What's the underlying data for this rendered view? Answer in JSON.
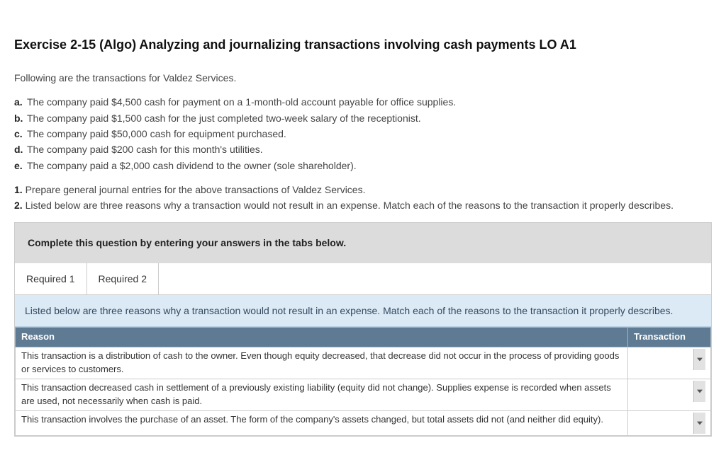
{
  "title": "Exercise 2-15 (Algo) Analyzing and journalizing transactions involving cash payments LO A1",
  "intro": "Following are the transactions for Valdez Services.",
  "items": [
    {
      "label": "a.",
      "text": "The company paid $4,500 cash for payment on a 1-month-old account payable for office supplies."
    },
    {
      "label": "b.",
      "text": "The company paid $1,500 cash for the just completed two-week salary of the receptionist."
    },
    {
      "label": "c.",
      "text": "The company paid $50,000 cash for equipment purchased."
    },
    {
      "label": "d.",
      "text": "The company paid $200 cash for this month's utilities."
    },
    {
      "label": "e.",
      "text": "The company paid a $2,000 cash dividend to the owner (sole shareholder)."
    }
  ],
  "tasks": [
    {
      "label": "1.",
      "text": "Prepare general journal entries for the above transactions of Valdez Services."
    },
    {
      "label": "2.",
      "text": "Listed below are three reasons why a transaction would not result in an expense. Match each of the reasons to the transaction it properly describes."
    }
  ],
  "panel": {
    "header": "Complete this question by entering your answers in the tabs below.",
    "tabs": [
      "Required 1",
      "Required 2"
    ],
    "prompt": "Listed below are three reasons why a transaction would not result in an expense. Match each of the reasons to the transaction it properly describes.",
    "columns": {
      "reason": "Reason",
      "transaction": "Transaction"
    },
    "rows": [
      "This transaction is a distribution of cash to the owner. Even though equity decreased, that decrease did not occur in the process of providing goods or services to customers.",
      "This transaction decreased cash in settlement of a previously existing liability (equity did not change). Supplies expense is recorded when assets are used, not necessarily when cash is paid.",
      "This transaction involves the purchase of an asset. The form of the company's assets changed, but total assets did not (and neither did equity)."
    ]
  }
}
